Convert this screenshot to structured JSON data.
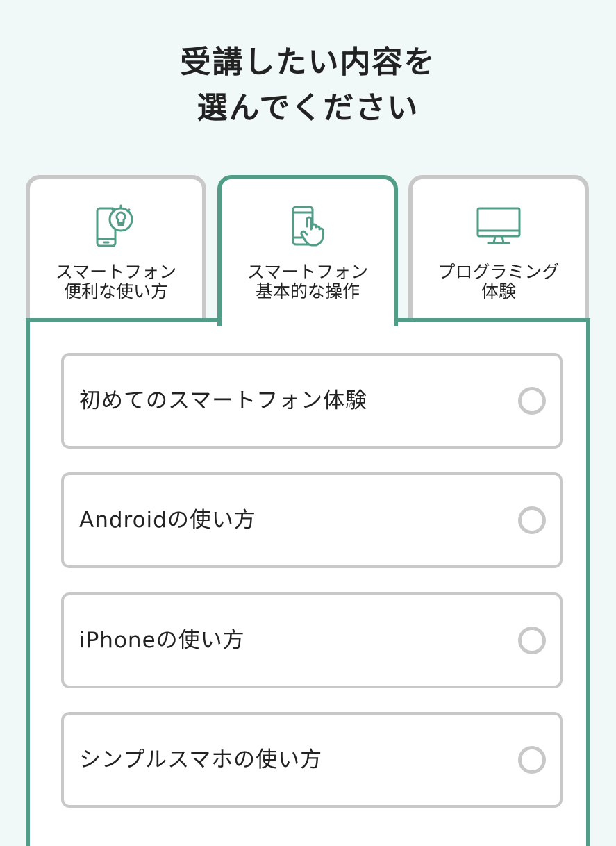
{
  "header": {
    "title_line1": "受講したい内容を",
    "title_line2": "選んでください"
  },
  "tabs": [
    {
      "id": "smartphone-tips",
      "icon": "smartphone-lightbulb-icon",
      "label_line1": "スマートフォン",
      "label_line2": "便利な使い方",
      "active": false
    },
    {
      "id": "smartphone-basics",
      "icon": "smartphone-touch-icon",
      "label_line1": "スマートフォン",
      "label_line2": "基本的な操作",
      "active": true
    },
    {
      "id": "programming",
      "icon": "desktop-monitor-icon",
      "label_line1": "プログラミング",
      "label_line2": "体験",
      "active": false
    }
  ],
  "options": [
    {
      "label": "初めてのスマートフォン体験",
      "selected": false
    },
    {
      "label": "Androidの使い方",
      "selected": false
    },
    {
      "label": "iPhoneの使い方",
      "selected": false
    },
    {
      "label": "シンプルスマホの使い方",
      "selected": false
    }
  ],
  "colors": {
    "accent": "#519d87",
    "background": "#f1f9f8",
    "border_inactive": "#c8c8c8",
    "text": "#222222"
  }
}
